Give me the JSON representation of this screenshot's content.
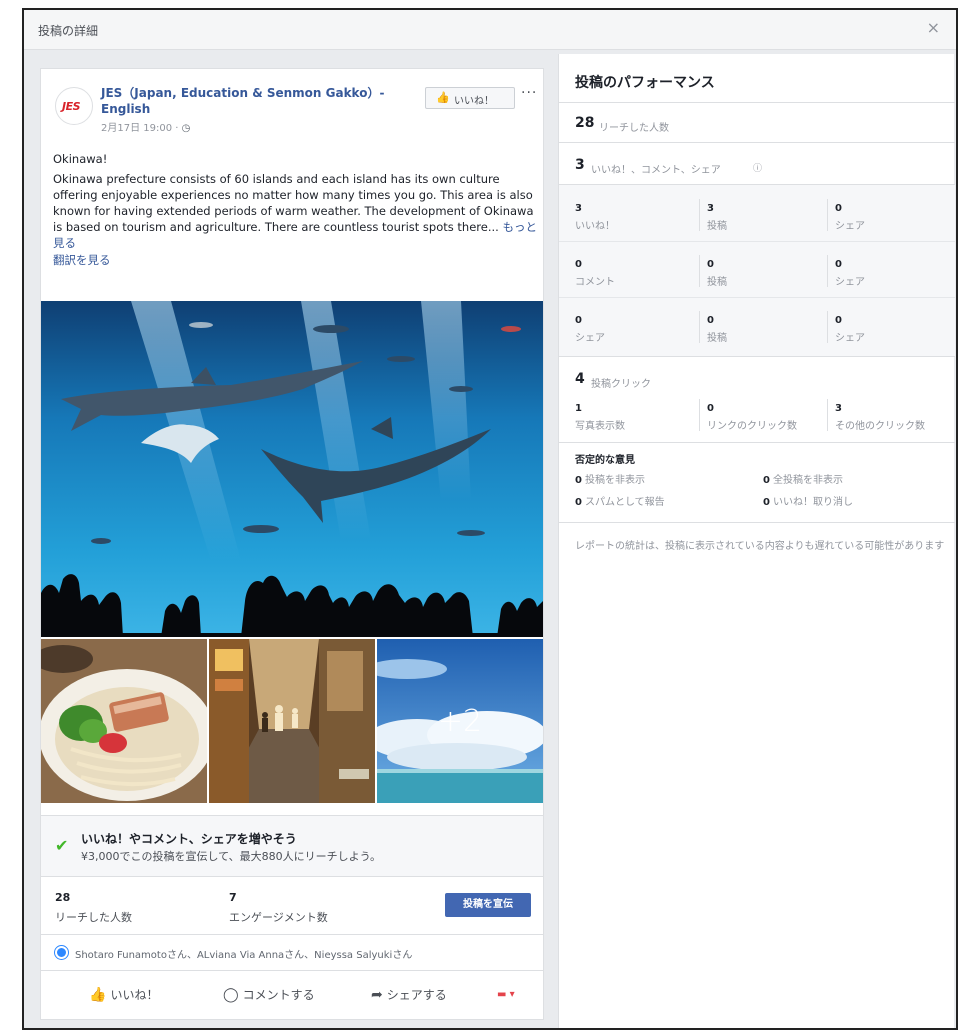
{
  "modal": {
    "title": "投稿の詳細",
    "close": "×"
  },
  "post": {
    "page_name": "JES（Japan, Education & Senmon Gakko）- English",
    "logo_text": "JES",
    "time": "2月17日 19:00 · ",
    "like_page_label": "いいね！",
    "more": "···",
    "heading": "Okinawa!",
    "body": "Okinawa prefecture consists of 60 islands and each island has its own culture offering enjoyable experiences no matter how many times you go. This area is also known for having extended periods of warm weather. The development of Okinawa is based on tourism and agriculture. There are countless tourist spots there...",
    "see_more": "もっと見る",
    "translate": "翻訳を見る",
    "more_photos": "+2"
  },
  "boost": {
    "title": "いいね！やコメント、シェアを増やそう",
    "desc": "¥3,000でこの投稿を宣伝して、最大880人にリーチしよう。",
    "button": "投稿を宣伝"
  },
  "post_stats": {
    "reach_value": "28",
    "reach_label": "リーチした人数",
    "engage_value": "7",
    "engage_label": "エンゲージメント数"
  },
  "reactors": "Shotaro Funamotoさん、ALviana Via Annaさん、Nieyssa Salyukiさん",
  "actions": {
    "like": "いいね！",
    "comment": "コメントする",
    "share": "シェアする"
  },
  "performance": {
    "title": "投稿のパフォーマンス",
    "reach_value": "28",
    "reach_label": "リーチした人数",
    "reactions_value": "3",
    "reactions_label": "いいね！、コメント、シェア",
    "grid": [
      {
        "label": "いいね！",
        "cells": [
          "3",
          "3",
          "0"
        ]
      },
      {
        "label": "コメント",
        "cells": [
          "0",
          "0",
          "0"
        ]
      },
      {
        "label": "シェア",
        "cells": [
          "0",
          "0",
          "0"
        ]
      }
    ],
    "col_labels": [
      "投稿",
      "シェア"
    ],
    "clicks_value": "4",
    "clicks_label": "投稿クリック",
    "click_cells": [
      {
        "value": "1",
        "label": "写真表示数"
      },
      {
        "value": "0",
        "label": "リンクのクリック数"
      },
      {
        "value": "3",
        "label": "その他のクリック数"
      }
    ],
    "negative_title": "否定的な意見",
    "negative": [
      {
        "value": "0",
        "label": "投稿を非表示"
      },
      {
        "value": "0",
        "label": "全投稿を非表示"
      },
      {
        "value": "0",
        "label": "スパムとして報告"
      },
      {
        "value": "0",
        "label": "いいね！取り消し"
      }
    ],
    "disclaimer": "レポートの統計は、投稿に表示されている内容よりも遅れている可能性があります"
  },
  "colors": {
    "accent": "#4267b2",
    "link": "#365899",
    "check": "#42b72a",
    "background": "#e9ebee"
  }
}
